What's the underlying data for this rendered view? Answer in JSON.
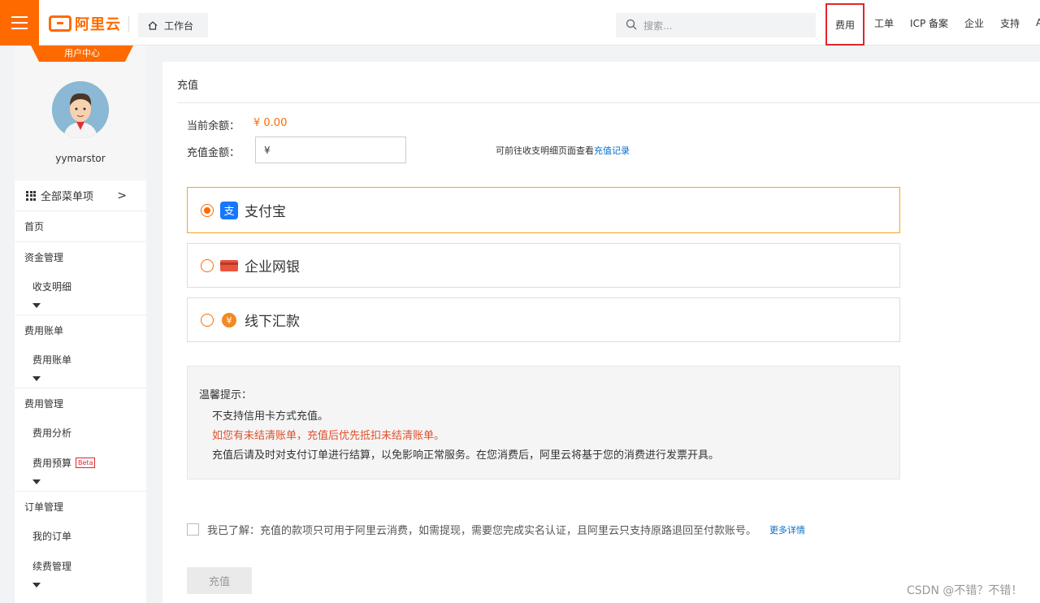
{
  "topbar": {
    "logo_text": "阿里云",
    "workbench_label": "工作台",
    "search_placeholder": "搜索...",
    "nav": [
      "费用",
      "工单",
      "ICP 备案",
      "企业",
      "支持",
      "A"
    ],
    "active_nav": "费用"
  },
  "sidebar": {
    "badge": "用户中心",
    "username": "yymarstor",
    "all_menu": "全部菜单项",
    "home": "首页",
    "groups": [
      {
        "label": "资金管理",
        "items": [
          "收支明细"
        ]
      },
      {
        "label": "费用账单",
        "items": [
          "费用账单"
        ]
      },
      {
        "label": "费用管理",
        "items": [
          "费用分析",
          "费用预算"
        ]
      },
      {
        "label": "订单管理",
        "items": [
          "我的订单",
          "续费管理"
        ]
      }
    ],
    "beta_badge": "Beta"
  },
  "main": {
    "title": "充值",
    "balance_label": "当前余额：",
    "balance_value": "¥ 0.00",
    "amount_label": "充值金额：",
    "amount_value": "¥",
    "record_hint": "可前往收支明细页面查看",
    "record_link": "充值记录",
    "payment_options": [
      {
        "label": "支付宝",
        "selected": true,
        "icon": "alipay-icon"
      },
      {
        "label": "企业网银",
        "selected": false,
        "icon": "bank-card-icon"
      },
      {
        "label": "线下汇款",
        "selected": false,
        "icon": "yuan-coin-icon"
      }
    ],
    "notice": {
      "title": "温馨提示：",
      "lines": [
        "不支持信用卡方式充值。",
        "如您有未结清账单，充值后优先抵扣未结清账单。",
        "充值后请及时对支付订单进行结算，以免影响正常服务。在您消费后，阿里云将基于您的消费进行发票开具。"
      ]
    },
    "agree_text": "我已了解：充值的款项只可用于阿里云消费，如需提现，需要您完成实名认证，且阿里云只支持原路退回至付款账号。",
    "more_link": "更多详情",
    "submit_label": "充值"
  },
  "watermark": "CSDN @不错？不错！",
  "colors": {
    "accent": "#ff6a00",
    "link": "#0070cc",
    "warn": "#e0502c",
    "highlight_box": "#e0262c"
  }
}
